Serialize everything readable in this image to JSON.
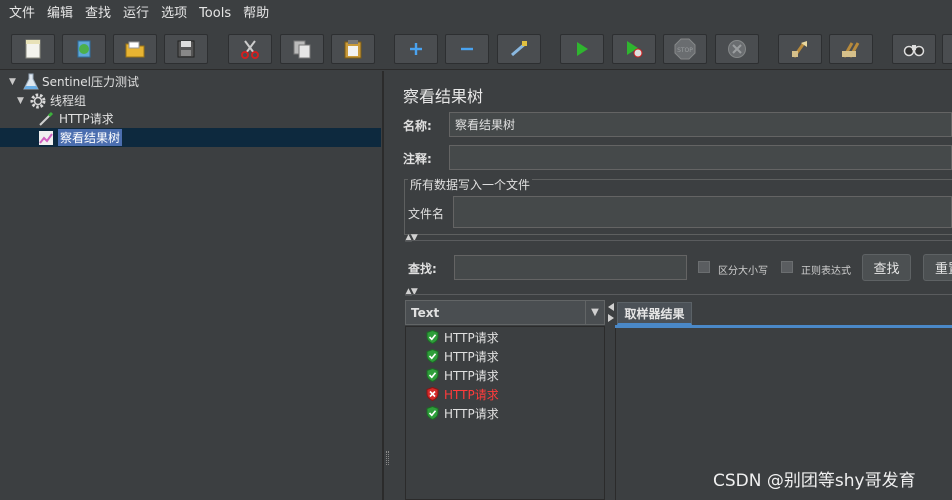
{
  "menu": [
    "文件",
    "编辑",
    "查找",
    "运行",
    "选项",
    "Tools",
    "帮助"
  ],
  "toolbar": {
    "icons": [
      "new-icon",
      "templates-icon",
      "open-icon",
      "save-icon",
      "cut-icon",
      "copy-icon",
      "paste-icon",
      "expand-icon",
      "collapse-icon",
      "toggle-icon",
      "start-icon",
      "start-no-pause-icon",
      "stop-icon",
      "shutdown-icon",
      "clear-icon",
      "clear-all-icon",
      "search-icon"
    ],
    "stop_label": "STOP"
  },
  "tree": {
    "root": "Sentinel压力测试",
    "thread_group": "线程组",
    "http_sampler": "HTTP请求",
    "listener": "察看结果树"
  },
  "panel": {
    "title": "察看结果树",
    "name_label": "名称:",
    "name_value": "察看结果树",
    "comment_label": "注释:",
    "comment_value": "",
    "group_title": "所有数据写入一个文件",
    "filename_label": "文件名",
    "filename_value": ""
  },
  "search": {
    "label": "查找:",
    "value": "",
    "case_label": "区分大小写",
    "regex_label": "正则表达式",
    "search_button": "查找",
    "reset_button": "重置"
  },
  "results": {
    "renderer": "Text",
    "items": [
      {
        "label": "HTTP请求",
        "status": "success"
      },
      {
        "label": "HTTP请求",
        "status": "success"
      },
      {
        "label": "HTTP请求",
        "status": "success"
      },
      {
        "label": "HTTP请求",
        "status": "error"
      },
      {
        "label": "HTTP请求",
        "status": "success"
      }
    ],
    "tab_label": "取样器结果"
  },
  "watermark": "CSDN @别团等shy哥发育",
  "colors": {
    "background": "#3c3f41",
    "selection": "#0d293e",
    "selected_label": "#4b6eaf",
    "error_text": "#ff3b3b",
    "success_icon": "#2e9e3a",
    "tab_accent": "#4a88c7"
  }
}
